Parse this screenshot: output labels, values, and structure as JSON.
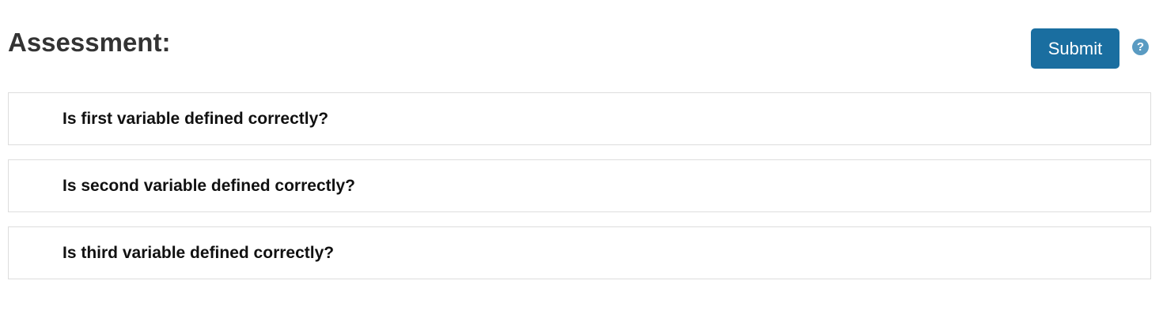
{
  "header": {
    "title": "Assessment:",
    "submit_label": "Submit",
    "help_icon": "question-circle-icon",
    "help_glyph": "?"
  },
  "questions": [
    {
      "text": "Is first variable defined correctly?"
    },
    {
      "text": "Is second variable defined correctly?"
    },
    {
      "text": "Is third variable defined correctly?"
    }
  ],
  "colors": {
    "primary": "#1a6ea0",
    "help_icon": "#5a9bc2",
    "border": "#dddddd",
    "title_text": "#333333"
  }
}
